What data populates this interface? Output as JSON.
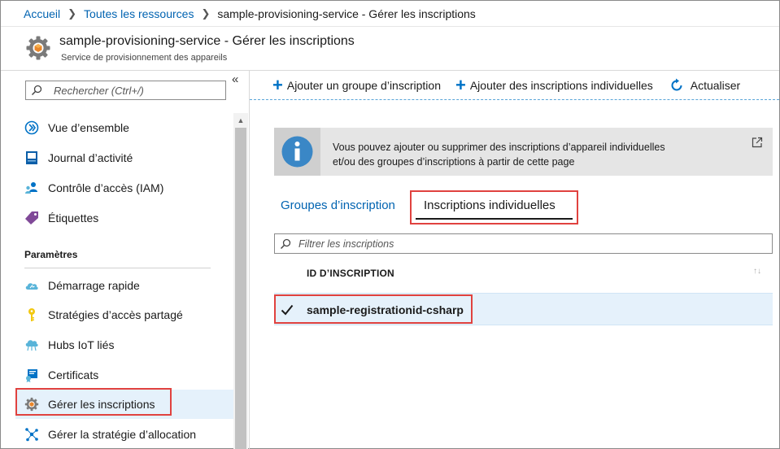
{
  "breadcrumb": {
    "home": "Accueil",
    "resources": "Toutes les ressources",
    "current": "sample-provisioning-service - Gérer les inscriptions",
    "separator": ">"
  },
  "header": {
    "title": "sample-provisioning-service - Gérer les inscriptions",
    "subtitle": "Service de provisionnement des appareils",
    "icon": "gear-icon"
  },
  "sidebar": {
    "search_placeholder": "Rechercher (Ctrl+/)",
    "collapse_label": "«",
    "items": [
      {
        "label": "Vue d’ensemble",
        "icon": "overview-icon"
      },
      {
        "label": "Journal d’activité",
        "icon": "activity-log-icon"
      },
      {
        "label": "Contrôle d’accès (IAM)",
        "icon": "access-control-icon"
      },
      {
        "label": "Étiquettes",
        "icon": "tag-icon"
      }
    ],
    "section_title": "Paramètres",
    "settings_items": [
      {
        "label": "Démarrage rapide",
        "icon": "cloud-quickstart-icon"
      },
      {
        "label": "Stratégies d’accès partagé",
        "icon": "key-icon"
      },
      {
        "label": "Hubs IoT liés",
        "icon": "iot-hub-icon"
      },
      {
        "label": "Certificats",
        "icon": "certificate-icon"
      },
      {
        "label": "Gérer les inscriptions",
        "icon": "gear-icon",
        "active": true
      },
      {
        "label": "Gérer la stratégie d’allocation",
        "icon": "allocation-icon"
      }
    ]
  },
  "toolbar": {
    "add_group": "Ajouter un groupe d’inscription",
    "add_individual": "Ajouter des inscriptions individuelles",
    "refresh": "Actualiser"
  },
  "info": {
    "line1": "Vous pouvez ajouter ou supprimer des inscriptions d’appareil individuelles",
    "line2": "et/ou des groupes d’inscriptions à partir de cette page"
  },
  "tabs": {
    "groups": "Groupes d’inscription",
    "individual": "Inscriptions individuelles",
    "selected": "individual"
  },
  "filter": {
    "placeholder": "Filtrer les inscriptions"
  },
  "table": {
    "column": "ID D’INSCRIPTION",
    "rows": [
      {
        "id": "sample-registrationid-csharp",
        "checked": true
      }
    ]
  },
  "colors": {
    "accent": "#0072c6",
    "link": "#0063b1",
    "highlight_box": "#e0423f",
    "selected_row": "#e5f1fb"
  }
}
